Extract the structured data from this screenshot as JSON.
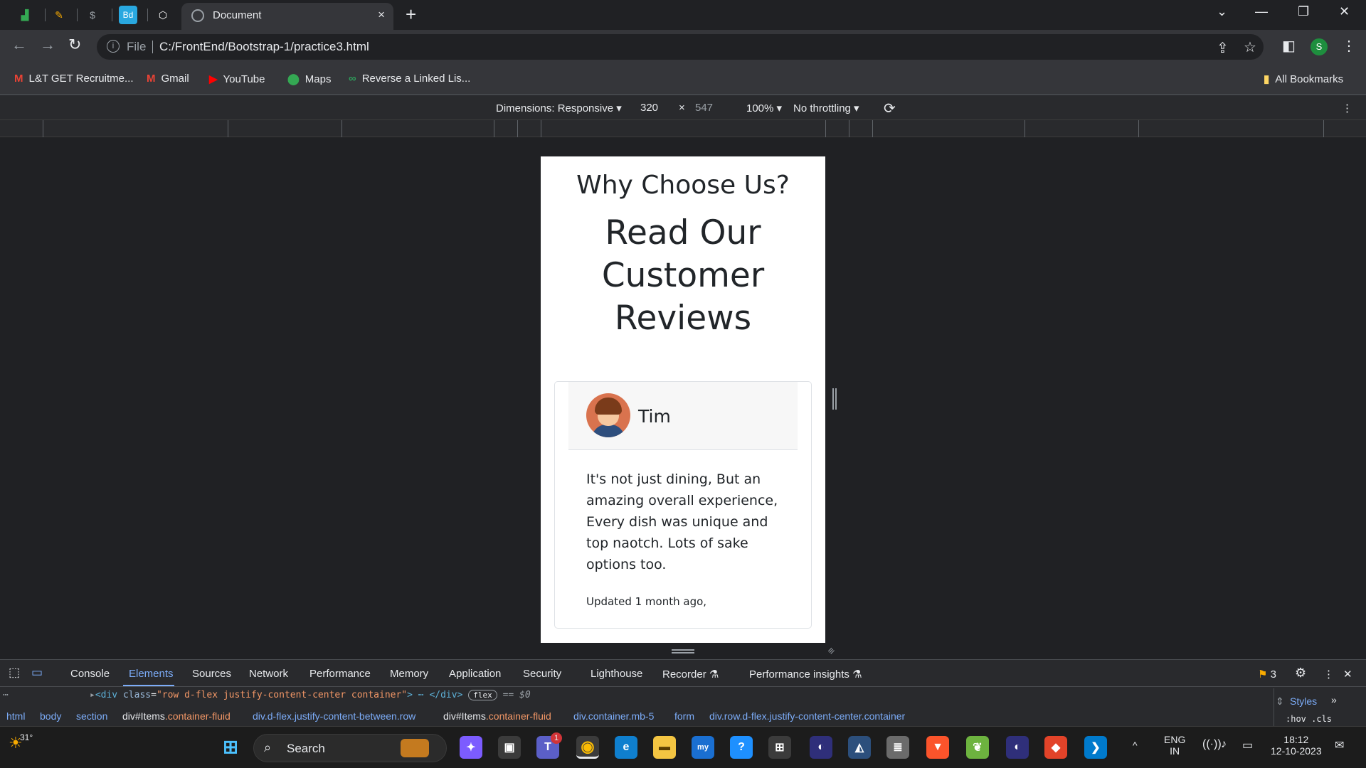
{
  "browser": {
    "tab_title": "Document",
    "tab_close": "×",
    "new_tab": "+",
    "url_scheme": "File",
    "url": "C:/FrontEnd/Bootstrap-1/practice3.html",
    "profile_initial": "S"
  },
  "bookmarks": [
    {
      "label": "L&T GET Recruitme...",
      "icon": "gmail-icon"
    },
    {
      "label": "Gmail",
      "icon": "gmail-icon"
    },
    {
      "label": "YouTube",
      "icon": "youtube-icon"
    },
    {
      "label": "Maps",
      "icon": "maps-icon"
    },
    {
      "label": "Reverse a Linked Lis...",
      "icon": "link-icon"
    }
  ],
  "all_bookmarks": "All Bookmarks",
  "device_toolbar": {
    "dimensions": "Dimensions: Responsive",
    "width": "320",
    "times": "×",
    "height": "547",
    "zoom": "100%",
    "throttling": "No throttling"
  },
  "page": {
    "subtitle": "Why Choose Us?",
    "title": "Read Our Customer Reviews",
    "review": {
      "name": "Tim",
      "text": "It's not just dining, But an amazing overall experience, Every dish was unique and top naotch. Lots of sake options too.",
      "updated": "Updated 1 month ago,"
    }
  },
  "devtools": {
    "tabs": [
      "Console",
      "Elements",
      "Sources",
      "Network",
      "Performance",
      "Memory",
      "Application",
      "Security",
      "Lighthouse",
      "Recorder",
      "Performance insights"
    ],
    "active_tab": "Elements",
    "issues_count": "3",
    "dom_line": {
      "tag_open": "<div",
      "attr": "class",
      "value": "\"row d-flex justify-content-center container\"",
      "close": "> ⋯ </div>",
      "pill": "flex",
      "eq": "== $0"
    },
    "breadcrumbs": [
      {
        "pre": "html",
        "hl": ""
      },
      {
        "pre": "body",
        "hl": ""
      },
      {
        "pre": "section",
        "hl": ""
      },
      {
        "pre": "div#Items",
        "hl": ".container-fluid"
      },
      {
        "pre": "div.d-flex.justify-content-between.row",
        "hl": ""
      },
      {
        "pre": "div#Items",
        "hl": ".container-fluid"
      },
      {
        "pre": "div.container.mb-5",
        "hl": ""
      },
      {
        "pre": "form",
        "hl": ""
      },
      {
        "pre": "div.row.d-flex.justify-content-center.container",
        "hl": ""
      }
    ],
    "styles_label": "Styles",
    "hov_cls": ":hov .cls"
  },
  "taskbar": {
    "weather": "31°",
    "search": "Search",
    "lang": "ENG",
    "region": "IN",
    "time": "18:12",
    "date": "12-10-2023",
    "teams_badge": "1"
  },
  "colors": {
    "accent": "#7cacf8",
    "page_bg": "#ffffff",
    "chrome_bg": "#202124"
  }
}
